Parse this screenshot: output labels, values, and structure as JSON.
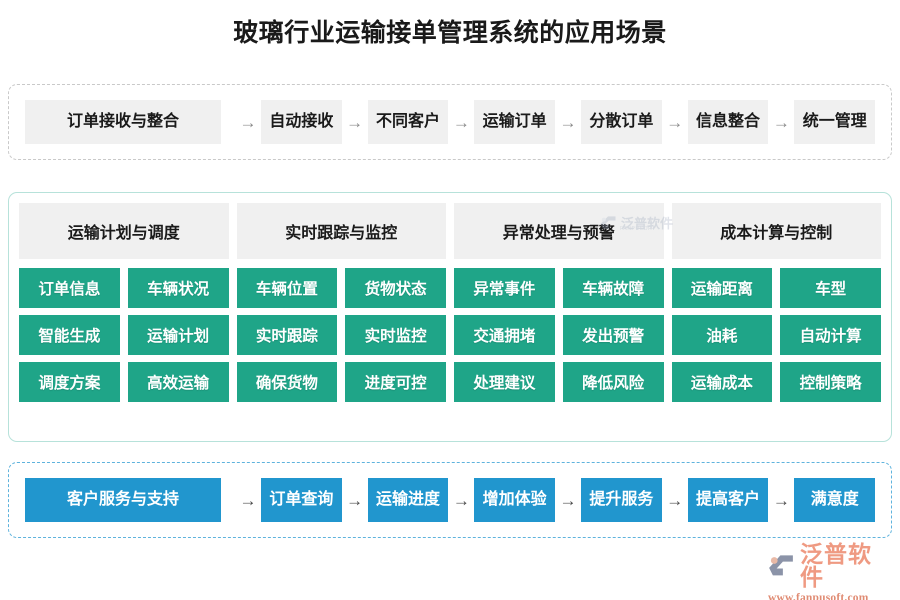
{
  "page": {
    "title": "玻璃行业运输接单管理系统的应用场景",
    "background_color": "#ffffff"
  },
  "colors": {
    "green": "#1fa588",
    "blue": "#2196ce",
    "chip_gray": "#f0f0f0",
    "dashed_gray_border": "#c9c9c9",
    "solid_teal_border": "#b7e2da",
    "dashed_blue_border": "#5fb3dd",
    "logo_salmon": "#ef9a82",
    "logo_mark_gray": "#8b93a8",
    "text_dark": "#1a1a1a",
    "arrow_gray": "#8a8a8a",
    "arrow_dark": "#4a4a4a"
  },
  "flow_top": {
    "lead_label": "订单接收与整合",
    "arrow_glyph": "→",
    "steps": [
      "自动接收",
      "不同客户",
      "运输订单",
      "分散订单",
      "信息整合",
      "统一管理"
    ]
  },
  "matrix": {
    "headers": [
      "运输计划与调度",
      "实时跟踪与监控",
      "异常处理与预警",
      "成本计算与控制"
    ],
    "columns": [
      {
        "header": "运输计划与调度",
        "cells": [
          "订单信息",
          "智能生成",
          "调度方案"
        ]
      },
      {
        "header": "运输计划与调度",
        "cells": [
          "车辆状况",
          "运输计划",
          "高效运输"
        ]
      },
      {
        "header": "实时跟踪与监控",
        "cells": [
          "车辆位置",
          "实时跟踪",
          "确保货物"
        ]
      },
      {
        "header": "实时跟踪与监控",
        "cells": [
          "货物状态",
          "实时监控",
          "进度可控"
        ]
      },
      {
        "header": "异常处理与预警",
        "cells": [
          "异常事件",
          "交通拥堵",
          "处理建议"
        ]
      },
      {
        "header": "异常处理与预警",
        "cells": [
          "车辆故障",
          "发出预警",
          "降低风险"
        ]
      },
      {
        "header": "成本计算与控制",
        "cells": [
          "运输距离",
          "油耗",
          "运输成本"
        ]
      },
      {
        "header": "成本计算与控制",
        "cells": [
          "车型",
          "自动计算",
          "控制策略"
        ]
      }
    ],
    "rows": [
      [
        "订单信息",
        "车辆状况",
        "车辆位置",
        "货物状态",
        "异常事件",
        "车辆故障",
        "运输距离",
        "车型"
      ],
      [
        "智能生成",
        "运输计划",
        "实时跟踪",
        "实时监控",
        "交通拥堵",
        "发出预警",
        "油耗",
        "自动计算"
      ],
      [
        "调度方案",
        "高效运输",
        "确保货物",
        "进度可控",
        "处理建议",
        "降低风险",
        "运输成本",
        "控制策略"
      ]
    ]
  },
  "flow_bottom": {
    "lead_label": "客户服务与支持",
    "arrow_glyph": "→",
    "steps": [
      "订单查询",
      "运输进度",
      "增加体验",
      "提升服务",
      "提高客户",
      "满意度"
    ]
  },
  "watermark": {
    "text": "泛普软件",
    "sub": "FANPUSOFT"
  },
  "logo": {
    "name": "泛普软件",
    "url": "www.fanpusoft.com"
  }
}
